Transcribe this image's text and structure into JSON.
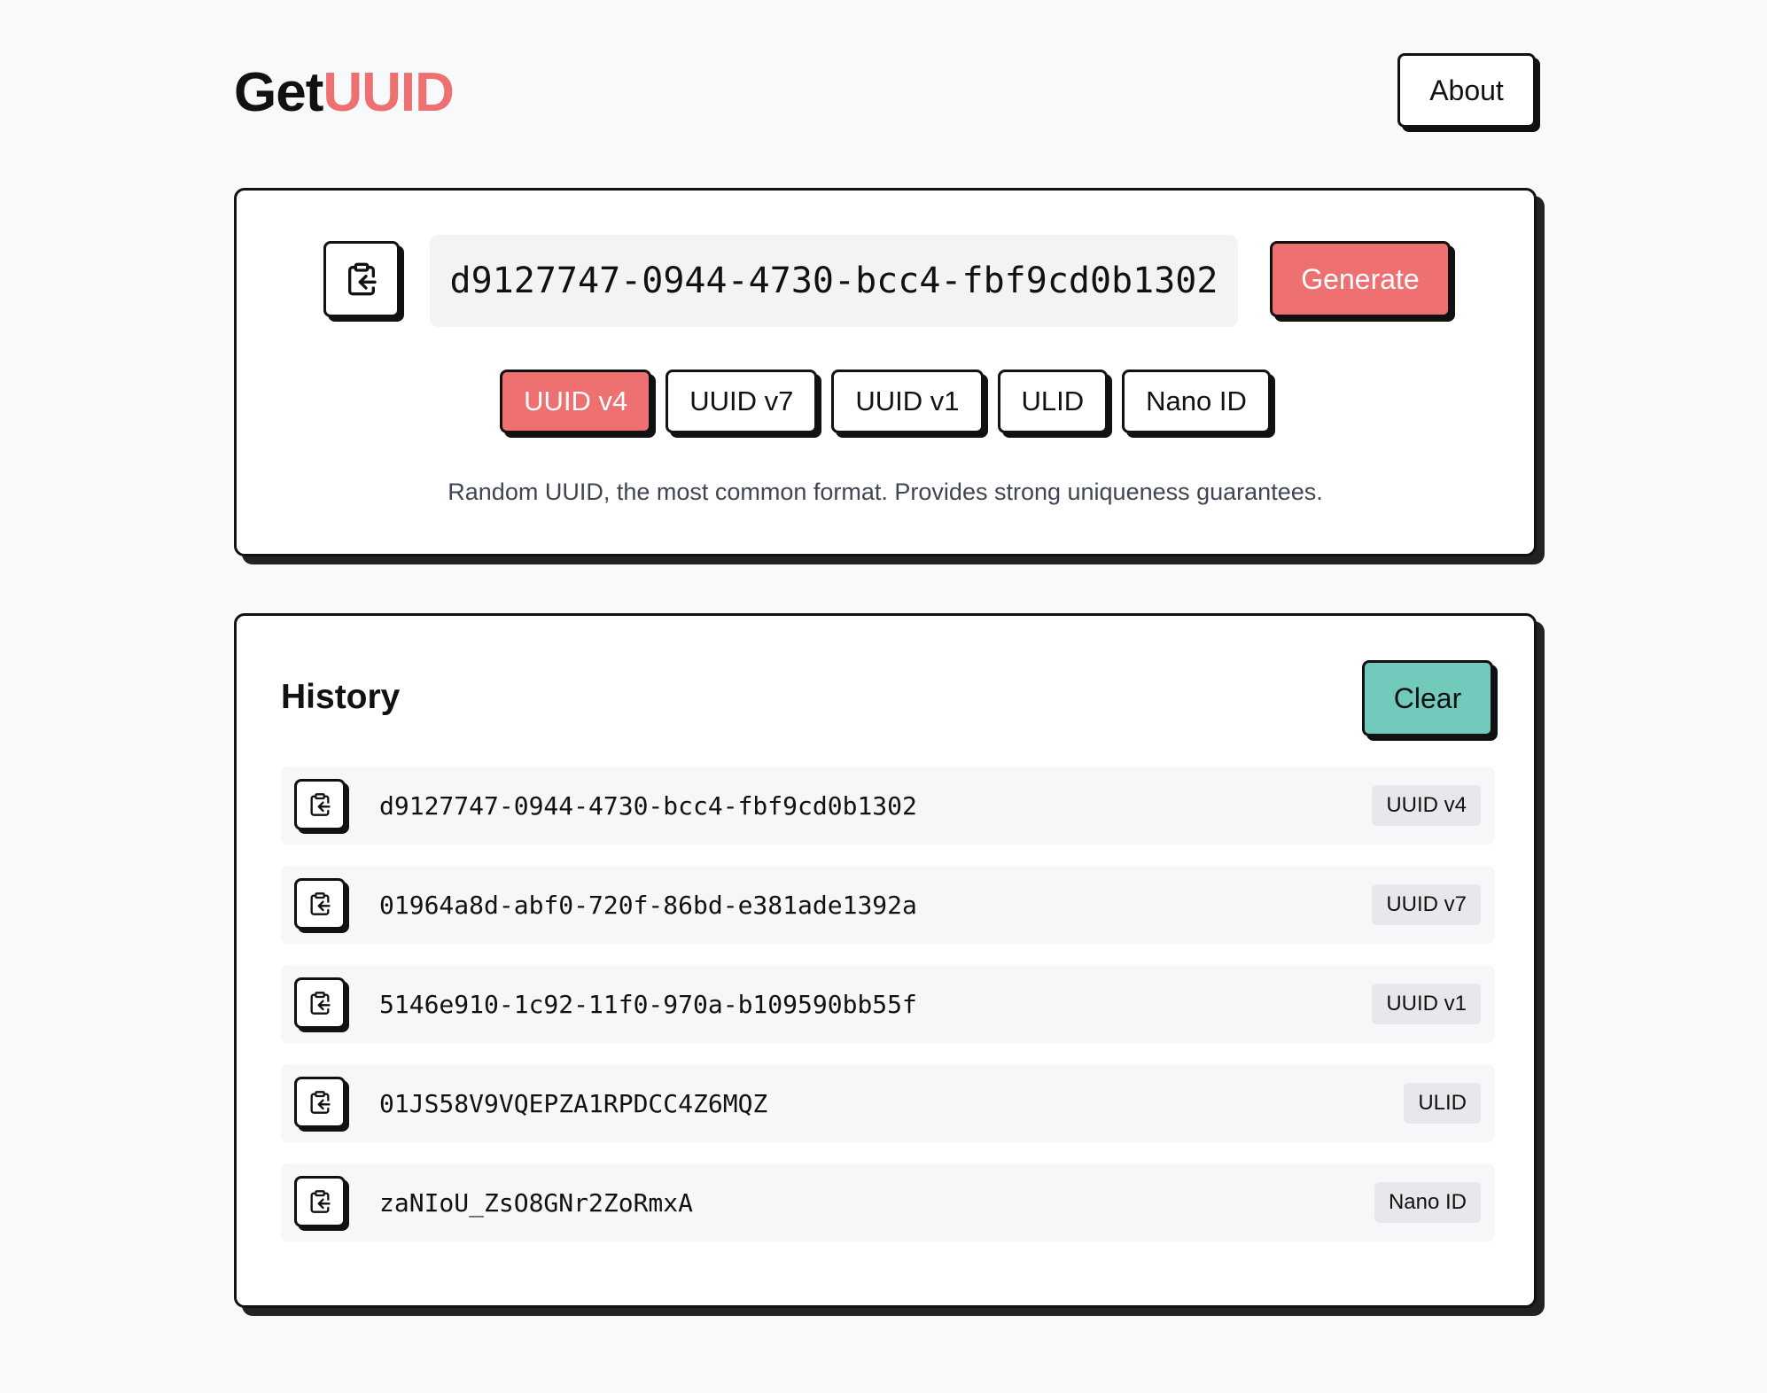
{
  "header": {
    "logo_prefix": "Get",
    "logo_accent": "UUID",
    "about_label": "About"
  },
  "generator": {
    "current_value": "d9127747-0944-4730-bcc4-fbf9cd0b1302",
    "copy_icon": "clipboard-copy-icon",
    "generate_label": "Generate",
    "types": [
      {
        "label": "UUID v4",
        "active": true
      },
      {
        "label": "UUID v7",
        "active": false
      },
      {
        "label": "UUID v1",
        "active": false
      },
      {
        "label": "ULID",
        "active": false
      },
      {
        "label": "Nano ID",
        "active": false
      }
    ],
    "description": "Random UUID, the most common format. Provides strong uniqueness guarantees."
  },
  "history": {
    "title": "History",
    "clear_label": "Clear",
    "items": [
      {
        "value": "d9127747-0944-4730-bcc4-fbf9cd0b1302",
        "type": "UUID v4"
      },
      {
        "value": "01964a8d-abf0-720f-86bd-e381ade1392a",
        "type": "UUID v7"
      },
      {
        "value": "5146e910-1c92-11f0-970a-b109590bb55f",
        "type": "UUID v1"
      },
      {
        "value": "01JS58V9VQEPZA1RPDCC4Z6MQZ",
        "type": "ULID"
      },
      {
        "value": "zaNIoU_ZsO8GNr2ZoRmxA",
        "type": "Nano ID"
      }
    ]
  },
  "colors": {
    "accent": "#ee7070",
    "clear": "#72cabd",
    "background": "#f8f9fb"
  }
}
